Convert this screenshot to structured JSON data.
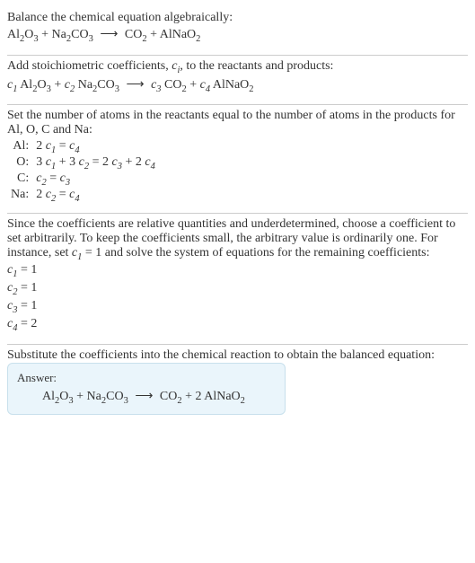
{
  "problem": {
    "intro": "Balance the chemical equation algebraically:",
    "equation_html": "Al<span class='sub'>2</span>O<span class='sub'>3</span> + Na<span class='sub'>2</span>CO<span class='sub'>3</span>&nbsp;<span class='arrow'>⟶</span>&nbsp;CO<span class='sub'>2</span> + AlNaO<span class='sub'>2</span>"
  },
  "step1": {
    "text_html": "Add stoichiometric coefficients, <span class='coef'>c<span class='sub'>i</span></span>, to the reactants and products:",
    "equation_html": "<span class='coef'>c<span class='sub'>1</span></span> Al<span class='sub'>2</span>O<span class='sub'>3</span> + <span class='coef'>c<span class='sub'>2</span></span> Na<span class='sub'>2</span>CO<span class='sub'>3</span>&nbsp;<span class='arrow'>⟶</span>&nbsp;<span class='coef'>c<span class='sub'>3</span></span> CO<span class='sub'>2</span> + <span class='coef'>c<span class='sub'>4</span></span> AlNaO<span class='sub'>2</span>"
  },
  "step2": {
    "text": "Set the number of atoms in the reactants equal to the number of atoms in the products for Al, O, C and Na:",
    "rows": [
      {
        "el": "Al:",
        "eq_html": "2 <span class='coef'>c<span class='sub'>1</span></span> = <span class='coef'>c<span class='sub'>4</span></span>"
      },
      {
        "el": "O:",
        "eq_html": "3 <span class='coef'>c<span class='sub'>1</span></span> + 3 <span class='coef'>c<span class='sub'>2</span></span> = 2 <span class='coef'>c<span class='sub'>3</span></span> + 2 <span class='coef'>c<span class='sub'>4</span></span>"
      },
      {
        "el": "C:",
        "eq_html": "<span class='coef'>c<span class='sub'>2</span></span> = <span class='coef'>c<span class='sub'>3</span></span>"
      },
      {
        "el": "Na:",
        "eq_html": "2 <span class='coef'>c<span class='sub'>2</span></span> = <span class='coef'>c<span class='sub'>4</span></span>"
      }
    ]
  },
  "step3": {
    "text_html": "Since the coefficients are relative quantities and underdetermined, choose a coefficient to set arbitrarily. To keep the coefficients small, the arbitrary value is ordinarily one. For instance, set <span class='coef'>c<span class='sub'>1</span></span> = 1 and solve the system of equations for the remaining coefficients:",
    "solutions": [
      "<span class='coef'>c<span class='sub'>1</span></span> = 1",
      "<span class='coef'>c<span class='sub'>2</span></span> = 1",
      "<span class='coef'>c<span class='sub'>3</span></span> = 1",
      "<span class='coef'>c<span class='sub'>4</span></span> = 2"
    ]
  },
  "step4": {
    "text": "Substitute the coefficients into the chemical reaction to obtain the balanced equation:"
  },
  "answer": {
    "label": "Answer:",
    "equation_html": "Al<span class='sub'>2</span>O<span class='sub'>3</span> + Na<span class='sub'>2</span>CO<span class='sub'>3</span>&nbsp;<span class='arrow'>⟶</span>&nbsp;CO<span class='sub'>2</span> + 2 AlNaO<span class='sub'>2</span>"
  }
}
